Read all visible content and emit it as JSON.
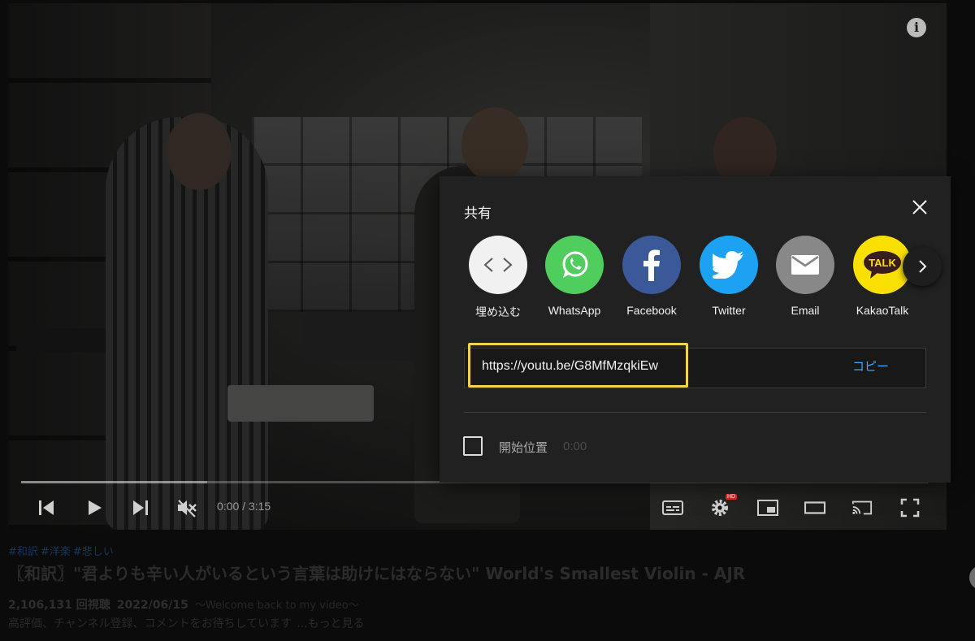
{
  "player": {
    "time_display": "0:00 / 3:15",
    "progress_fraction": 0.0,
    "buffered_fraction": 0.205,
    "hd_badge": "HD"
  },
  "share": {
    "title": "共有",
    "targets": [
      {
        "label": "埋め込む",
        "icon": "embed-code-icon",
        "color": "#f1f1f1"
      },
      {
        "label": "WhatsApp",
        "icon": "whatsapp-icon",
        "color": "#4fce5d"
      },
      {
        "label": "Facebook",
        "icon": "facebook-icon",
        "color": "#3b5998"
      },
      {
        "label": "Twitter",
        "icon": "twitter-icon",
        "color": "#1da1f2"
      },
      {
        "label": "Email",
        "icon": "email-icon",
        "color": "#888888"
      },
      {
        "label": "KakaoTalk",
        "icon": "kakaotalk-icon",
        "color": "#f9e000",
        "icon_text": "TALK"
      }
    ],
    "url": "https://youtu.be/G8MfMzqkiEw",
    "copy_label": "コピー",
    "start_at_label": "開始位置",
    "start_at_time": "0:00",
    "start_at_checked": false
  },
  "video_meta": {
    "hashtags": [
      "#和訳",
      "#洋楽",
      "#悲しい"
    ],
    "title": "〖和訳〗\"君よりも辛い人がいるという言葉は助けにはならない\" World's Smallest Violin - AJR",
    "views": "2,106,131 回視聴",
    "date": "2022/06/15",
    "welcome": "〜Welcome back to my video〜",
    "description": "高評価、チャンネル登録、コメントをお待ちしています",
    "more_label": "...もっと見る"
  },
  "colors": {
    "accent_blue": "#3ea6ff",
    "highlight_yellow": "#f1d34b",
    "dialog_bg": "#212121"
  }
}
